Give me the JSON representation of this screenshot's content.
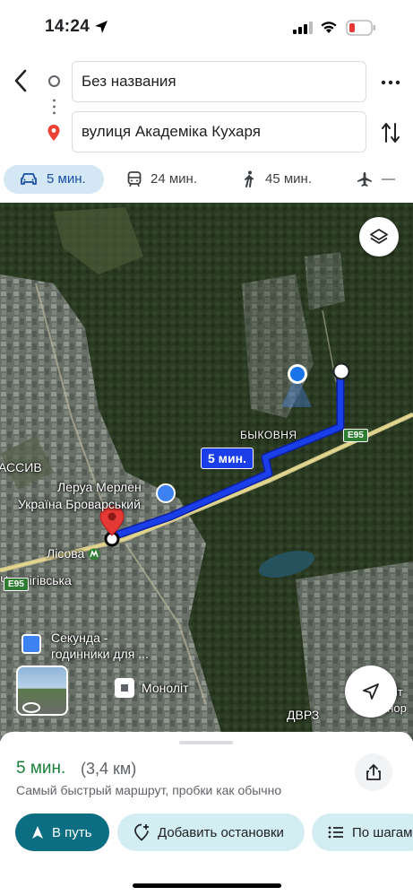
{
  "status_bar": {
    "time": "14:24"
  },
  "route": {
    "origin": "Без названия",
    "destination": "вулиця Академіка Кухаря"
  },
  "modes": [
    {
      "icon": "car-icon",
      "label": "5 мин."
    },
    {
      "icon": "transit-icon",
      "label": "24 мин."
    },
    {
      "icon": "walk-icon",
      "label": "45 мин."
    },
    {
      "icon": "plane-icon",
      "label": "—"
    }
  ],
  "map": {
    "labels": {
      "bykovnia": "БЫКОВНЯ",
      "massiv": "АССИВ",
      "leroy1": "Леруа Мерлен",
      "leroy2": "Україна Броварський",
      "lisova": "Лісова",
      "chernihivska": "Чернігівська",
      "sekunda1": "Секунда -",
      "sekunda2": "годинники для ...",
      "monolit": "Моноліт",
      "dvrz": "ДВРЗ",
      "right1": "іт",
      "right2": "онор"
    },
    "road_shields": {
      "e95_a": "E95",
      "e95_b": "E95"
    },
    "route_time": "5 мин."
  },
  "sheet": {
    "eta": "5 мин.",
    "distance": "(3,4 км)",
    "description": "Самый быстрый маршрут, пробки как обычно",
    "go_label": "В путь",
    "add_stops_label": "Добавить остановки",
    "steps_label": "По шагам"
  },
  "colors": {
    "route": "#1a3ee8",
    "eta": "#188038",
    "go_button": "#0b6e82",
    "chip": "#d3eef3",
    "active_mode": "#d3e7f5"
  }
}
